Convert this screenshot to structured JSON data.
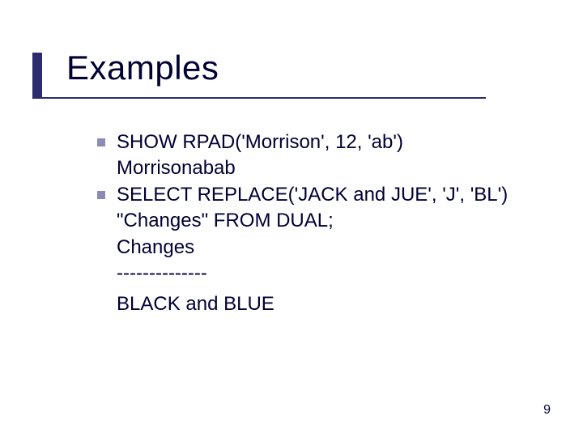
{
  "title": "Examples",
  "lines": {
    "l1": "SHOW RPAD('Morrison', 12, 'ab')",
    "l2": "Morrisonabab",
    "l3": "SELECT REPLACE('JACK and JUE', 'J', 'BL')",
    "l4": "\"Changes\" FROM DUAL;",
    "l5": "Changes",
    "l6": "--------------",
    "l7": "BLACK and BLUE"
  },
  "page_number": "9"
}
